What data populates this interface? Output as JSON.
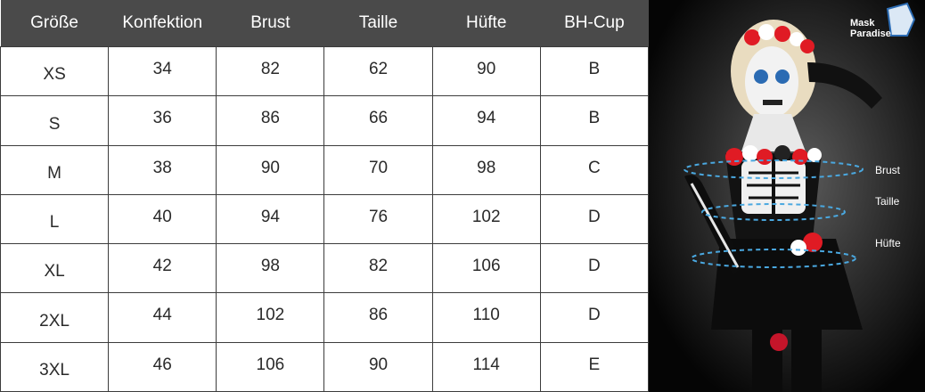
{
  "table": {
    "headers": [
      "Größe",
      "Konfektion",
      "Brust",
      "Taille",
      "Hüfte",
      "BH-Cup"
    ],
    "rows": [
      [
        "XS",
        "34",
        "82",
        "62",
        "90",
        "B"
      ],
      [
        "S",
        "36",
        "86",
        "66",
        "94",
        "B"
      ],
      [
        "M",
        "38",
        "90",
        "70",
        "98",
        "C"
      ],
      [
        "L",
        "40",
        "94",
        "76",
        "102",
        "D"
      ],
      [
        "XL",
        "42",
        "98",
        "82",
        "106",
        "D"
      ],
      [
        "2XL",
        "44",
        "102",
        "86",
        "110",
        "D"
      ],
      [
        "3XL",
        "46",
        "106",
        "90",
        "114",
        "E"
      ]
    ]
  },
  "photo": {
    "logo_line1": "Mask",
    "logo_line2": "Paradise",
    "labels": {
      "brust": "Brust",
      "taille": "Taille",
      "huefte": "Hüfte"
    }
  }
}
